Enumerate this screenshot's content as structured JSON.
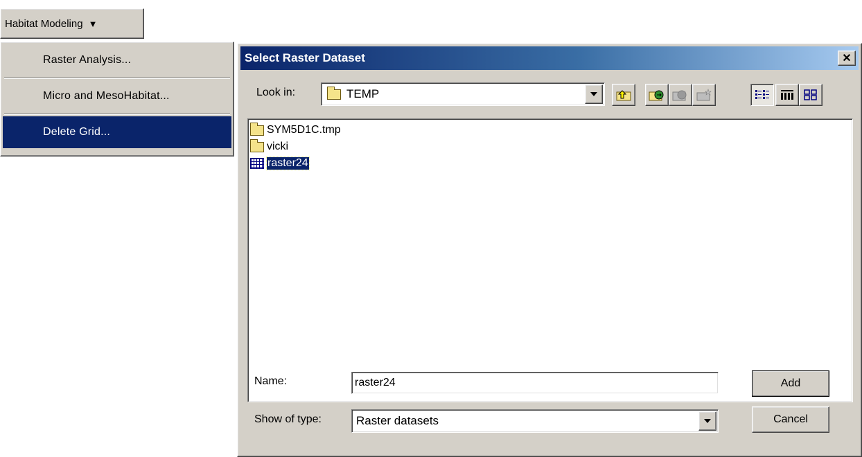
{
  "menu_button": {
    "label": "Habitat Modeling",
    "caret": "▼"
  },
  "menu": {
    "items": [
      {
        "label": "Raster Analysis..."
      },
      {
        "label": "Micro and MesoHabitat..."
      },
      {
        "label": "Delete Grid..."
      }
    ]
  },
  "dialog": {
    "title": "Select Raster Dataset",
    "close_glyph": "✕",
    "look_in_label": "Look in:",
    "look_in_value": "TEMP",
    "files": [
      {
        "name": "SYM5D1C.tmp",
        "icon": "folder-icon"
      },
      {
        "name": "vicki",
        "icon": "folder-icon"
      },
      {
        "name": "raster24",
        "icon": "raster-grid-icon",
        "selected": true
      }
    ],
    "name_label": "Name:",
    "name_value": "raster24",
    "type_label": "Show of type:",
    "type_value": "Raster datasets",
    "add_label": "Add",
    "cancel_label": "Cancel"
  },
  "colors": {
    "face": "#d4d0c8",
    "selection": "#0a246a",
    "title_start": "#0a246a",
    "title_end": "#a6caf0"
  }
}
